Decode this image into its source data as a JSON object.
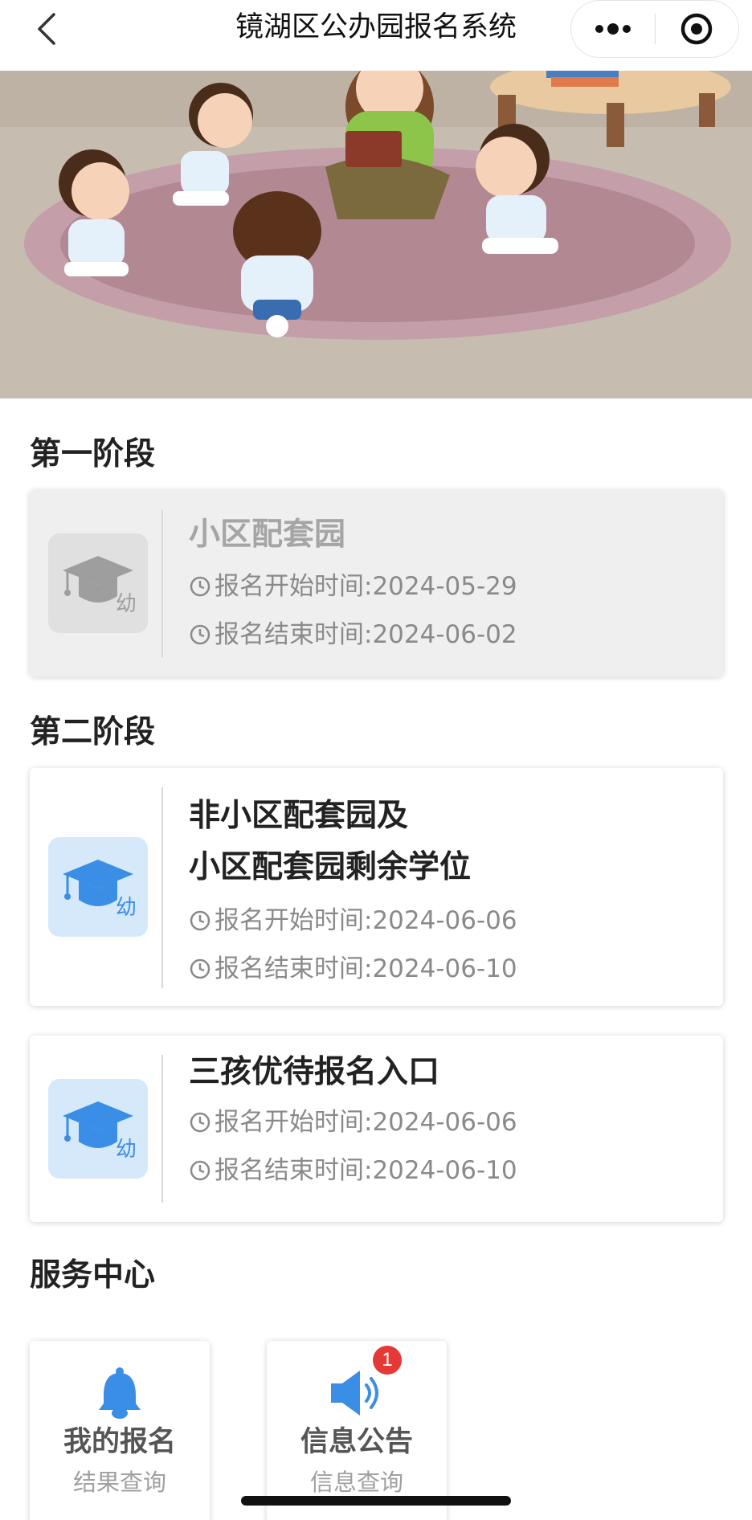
{
  "nav": {
    "title": "镜湖区公办园报名系统"
  },
  "sections": {
    "stage1": "第一阶段",
    "stage2": "第二阶段",
    "service": "服务中心"
  },
  "icon_glyph": "幼",
  "cards": [
    {
      "name": "小区配套园",
      "start": "报名开始时间:2024-05-29",
      "end": "报名结束时间:2024-06-02",
      "status": "disabled"
    },
    {
      "name_line1": "非小区配套园及",
      "name_line2": "小区配套园剩余学位",
      "start": "报名开始时间:2024-06-06",
      "end": "报名结束时间:2024-06-10",
      "status": "active"
    },
    {
      "name": "三孩优待报名入口",
      "start": "报名开始时间:2024-06-06",
      "end": "报名结束时间:2024-06-10",
      "status": "active"
    }
  ],
  "services": [
    {
      "title": "我的报名",
      "subtitle": "结果查询",
      "icon": "bell-icon"
    },
    {
      "title": "信息公告",
      "subtitle": "信息查询",
      "icon": "speaker-icon",
      "badge": "1"
    }
  ],
  "colors": {
    "accent": "#3a8ee6",
    "icon_bg": "#d6e9fb",
    "badge": "#e53935"
  }
}
